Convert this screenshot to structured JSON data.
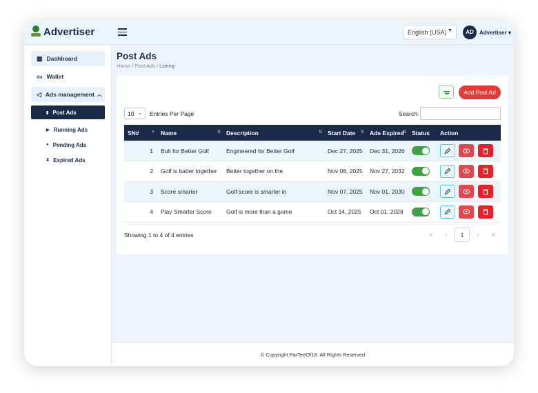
{
  "app": {
    "title": "Advertiser"
  },
  "header": {
    "language": "English (USA)",
    "avatar_initials": "AD",
    "user_name": "Advertiser"
  },
  "sidebar": {
    "items": [
      {
        "label": "Dashboard",
        "icon": "grid-icon"
      },
      {
        "label": "Wallet",
        "icon": "wallet-icon"
      },
      {
        "label": "Ads management",
        "icon": "megaphone-icon"
      }
    ],
    "sub_items": [
      {
        "label": "Post Ads",
        "active": true
      },
      {
        "label": "Running Ads"
      },
      {
        "label": "Pending Ads"
      },
      {
        "label": "Expired Ads"
      }
    ]
  },
  "page": {
    "title": "Post Ads",
    "breadcrumb": [
      "Home",
      "Post Ads",
      "Listing"
    ]
  },
  "toolbar": {
    "add_label": "Add Post Ad"
  },
  "table_controls": {
    "entries_value": "10",
    "entries_label": "Entries Per Page",
    "search_label": "Search:"
  },
  "table": {
    "columns": [
      "SN#",
      "Name",
      "Description",
      "Start Date",
      "Ads Expired",
      "Status",
      "Action"
    ],
    "rows": [
      {
        "sn": "1",
        "name": "Bult for Better Golf",
        "description": "Engineered for Better Golf",
        "start": "Dec 27, 2025",
        "expired": "Dec 31, 2026",
        "status_on": true
      },
      {
        "sn": "2",
        "name": "Golf is batter together",
        "description": "Better together on the",
        "start": "Nov 08, 2025",
        "expired": "Nov 27, 2032",
        "status_on": true
      },
      {
        "sn": "3",
        "name": "Score smarter",
        "description": "Golf score is smarter in",
        "start": "Nov 07, 2025",
        "expired": "Nov 01, 2030",
        "status_on": true
      },
      {
        "sn": "4",
        "name": "Play Smarter Score",
        "description": "Golf is more than a game",
        "start": "Oct 14, 2025",
        "expired": "Oct 01, 2028",
        "status_on": true
      }
    ]
  },
  "pagination": {
    "showing": "Showing 1 to 4 of 4 entries",
    "first": "«",
    "prev": "‹",
    "current": "1",
    "next": "›",
    "last": "»"
  },
  "footer": {
    "copyright": "© Copyright ParTeeOf18. All Rights Reserved"
  },
  "colors": {
    "primary": "#1a2b4a",
    "accent": "#e53935",
    "success": "#3fa141",
    "row_highlight": "#eaf4fb"
  }
}
